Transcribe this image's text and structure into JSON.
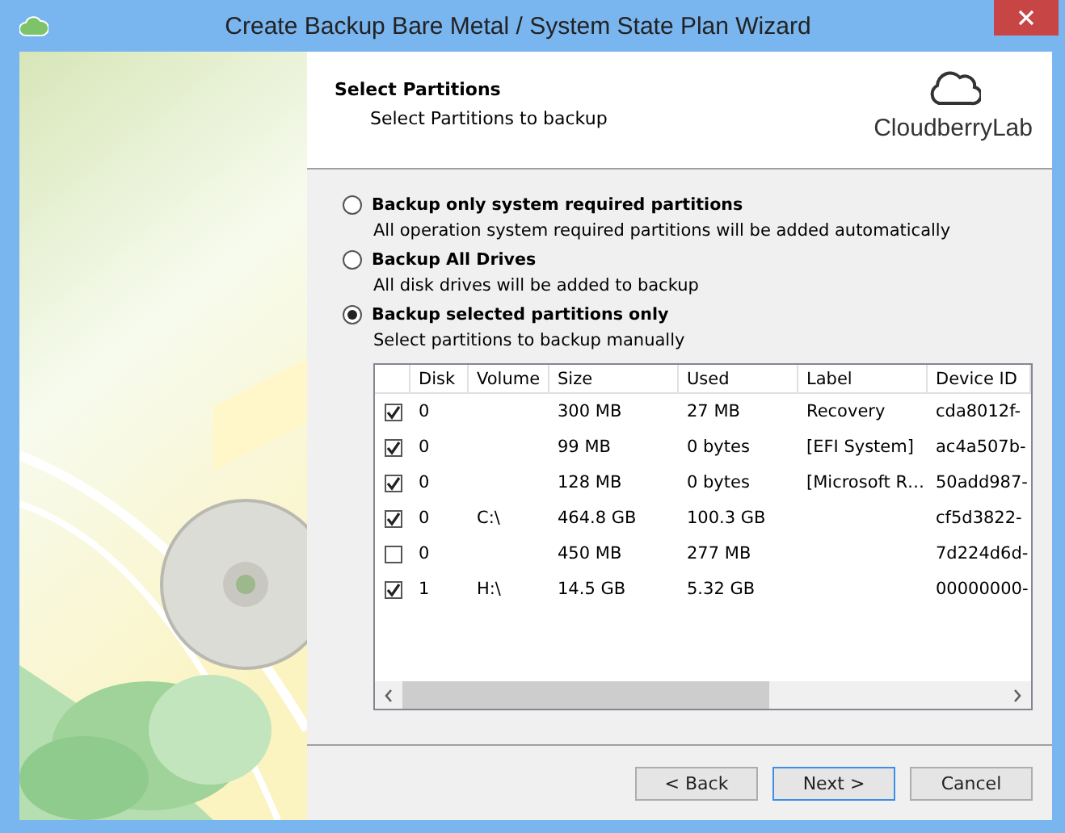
{
  "window": {
    "title": "Create Backup Bare Metal / System State Plan Wizard"
  },
  "header": {
    "title": "Select Partitions",
    "subtitle": "Select Partitions to backup",
    "logo": "CloudberryLab"
  },
  "options": [
    {
      "label": "Backup only system required partitions",
      "description": "All operation system required partitions will be added automatically",
      "selected": false
    },
    {
      "label": "Backup All Drives",
      "description": "All disk drives will be added to backup",
      "selected": false
    },
    {
      "label": "Backup selected partitions only",
      "description": "Select partitions to backup manually",
      "selected": true
    }
  ],
  "table": {
    "columns": [
      "Disk",
      "Volume",
      "Size",
      "Used",
      "Label",
      "Device ID"
    ],
    "rows": [
      {
        "checked": true,
        "cells": [
          "0",
          "",
          "300 MB",
          "27 MB",
          "Recovery",
          "cda8012f-"
        ]
      },
      {
        "checked": true,
        "cells": [
          "0",
          "",
          "99 MB",
          "0 bytes",
          "[EFI System]",
          "ac4a507b-"
        ]
      },
      {
        "checked": true,
        "cells": [
          "0",
          "",
          "128 MB",
          "0 bytes",
          "[Microsoft R…",
          "50add987-"
        ]
      },
      {
        "checked": true,
        "cells": [
          "0",
          "C:\\",
          "464.8 GB",
          "100.3 GB",
          "",
          "cf5d3822-"
        ]
      },
      {
        "checked": false,
        "cells": [
          "0",
          "",
          "450 MB",
          "277 MB",
          "",
          "7d224d6d-"
        ]
      },
      {
        "checked": true,
        "cells": [
          "1",
          "H:\\",
          "14.5 GB",
          "5.32 GB",
          "",
          "00000000-"
        ]
      }
    ]
  },
  "buttons": [
    {
      "label": "< Back",
      "selected": false
    },
    {
      "label": "Next >",
      "selected": true
    },
    {
      "label": "Cancel",
      "selected": false
    }
  ]
}
